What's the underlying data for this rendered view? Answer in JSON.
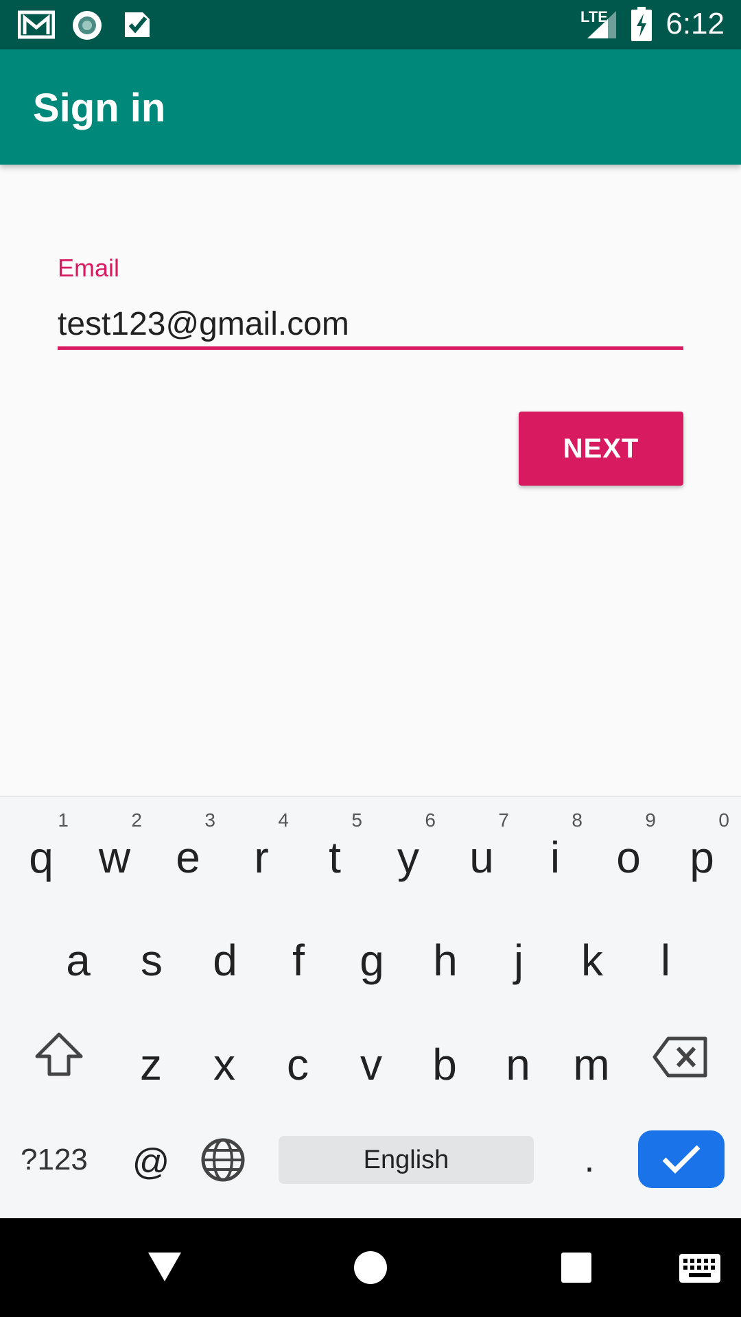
{
  "status_bar": {
    "time": "6:12",
    "network": "LTE",
    "icons": [
      "gmail-icon",
      "record-icon",
      "check-icon",
      "signal-icon",
      "battery-icon"
    ]
  },
  "app_bar": {
    "title": "Sign in"
  },
  "form": {
    "email_label": "Email",
    "email_value": "test123@gmail.com",
    "next_label": "NEXT"
  },
  "keyboard": {
    "row1": [
      {
        "key": "q",
        "hint": "1"
      },
      {
        "key": "w",
        "hint": "2"
      },
      {
        "key": "e",
        "hint": "3"
      },
      {
        "key": "r",
        "hint": "4"
      },
      {
        "key": "t",
        "hint": "5"
      },
      {
        "key": "y",
        "hint": "6"
      },
      {
        "key": "u",
        "hint": "7"
      },
      {
        "key": "i",
        "hint": "8"
      },
      {
        "key": "o",
        "hint": "9"
      },
      {
        "key": "p",
        "hint": "0"
      }
    ],
    "row2": [
      "a",
      "s",
      "d",
      "f",
      "g",
      "h",
      "j",
      "k",
      "l"
    ],
    "row3": [
      "z",
      "x",
      "c",
      "v",
      "b",
      "n",
      "m"
    ],
    "symbols_label": "?123",
    "at_label": "@",
    "space_label": "English",
    "period_label": "."
  },
  "colors": {
    "primary": "#00897b",
    "primary_dark": "#00574b",
    "accent": "#d81b60",
    "enter_key": "#1a73e8"
  }
}
